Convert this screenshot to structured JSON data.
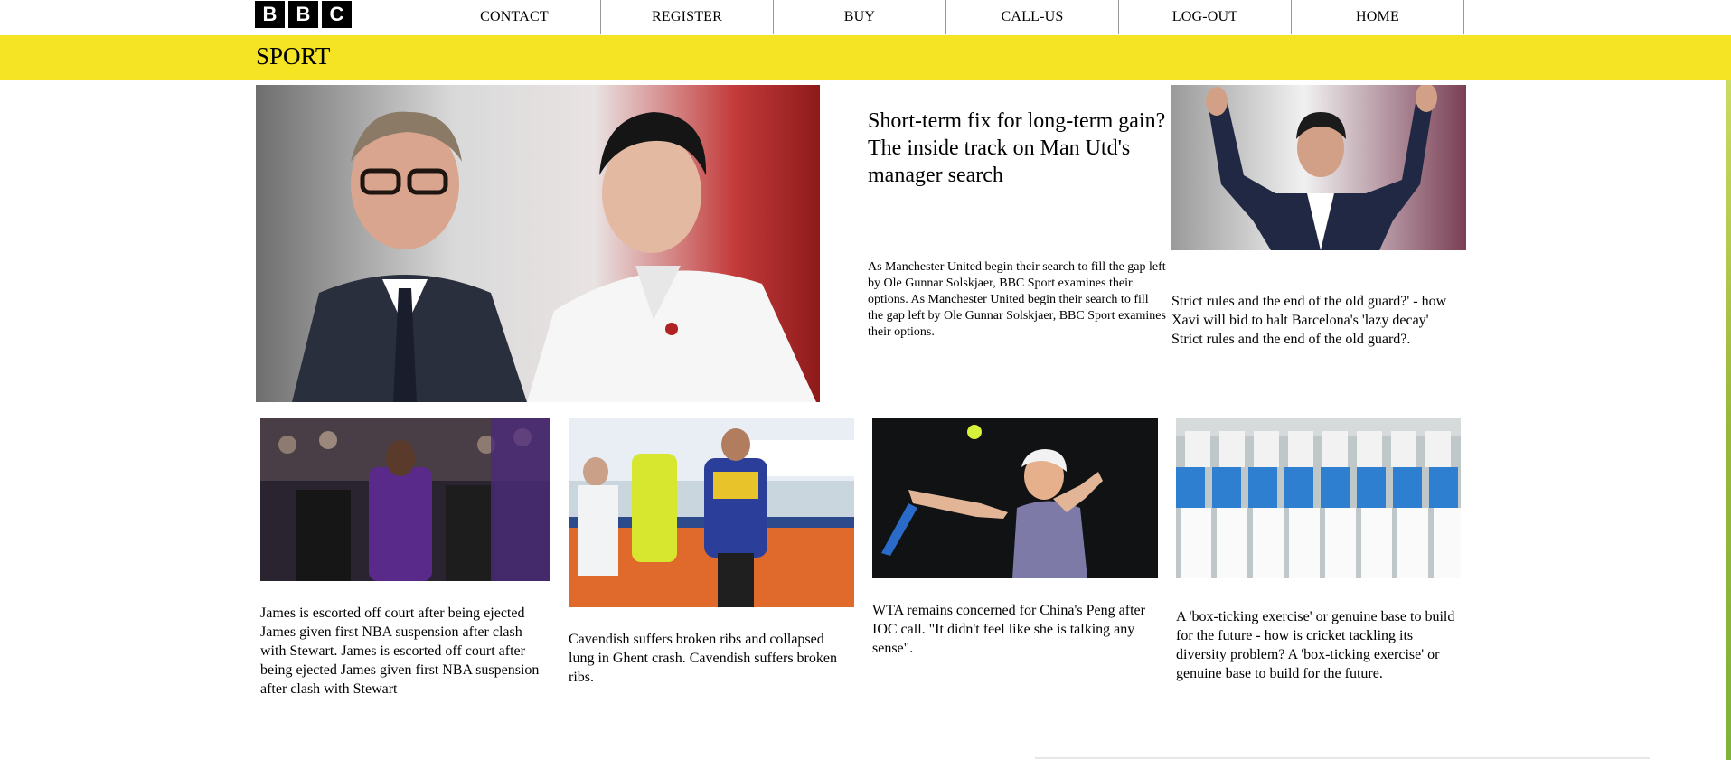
{
  "brand": {
    "logo_letters": [
      "B",
      "B",
      "C"
    ]
  },
  "nav": {
    "items": [
      {
        "label": "CONTACT"
      },
      {
        "label": "REGISTER"
      },
      {
        "label": "BUY"
      },
      {
        "label": "CALL-US"
      },
      {
        "label": "LOG-OUT"
      },
      {
        "label": "HOME"
      }
    ]
  },
  "section": {
    "title": "SPORT"
  },
  "featured": {
    "headline": "Short-term fix for long-term gain? The inside track on Man Utd's manager search",
    "summary": "As Manchester United begin their search to fill the gap left by Ole Gunnar Solskjaer, BBC Sport examines their options. As Manchester United begin their search to fill the gap left by Ole Gunnar Solskjaer, BBC Sport examines their options."
  },
  "side_story": {
    "caption": "Strict rules and the end of the old guard?' - how Xavi will bid to halt Barcelona's 'lazy decay' Strict rules and the end of the old guard?."
  },
  "stories": [
    {
      "caption": "James is escorted off court after being ejected James given first NBA suspension after clash with Stewart. James is escorted off court after being ejected James given first NBA suspension after clash with Stewart"
    },
    {
      "caption": "Cavendish suffers broken ribs and collapsed lung in Ghent crash. Cavendish suffers broken ribs."
    },
    {
      "caption": "WTA remains concerned for China's Peng after IOC call. \"It didn't feel like she is talking any sense\"."
    },
    {
      "caption": "A 'box-ticking exercise' or genuine base to build for the future - how is cricket tackling its diversity problem? A 'box-ticking exercise' or genuine base to build for the future."
    }
  ],
  "colors": {
    "sport_bar": "#f5e424",
    "logo_bg": "#000000"
  }
}
